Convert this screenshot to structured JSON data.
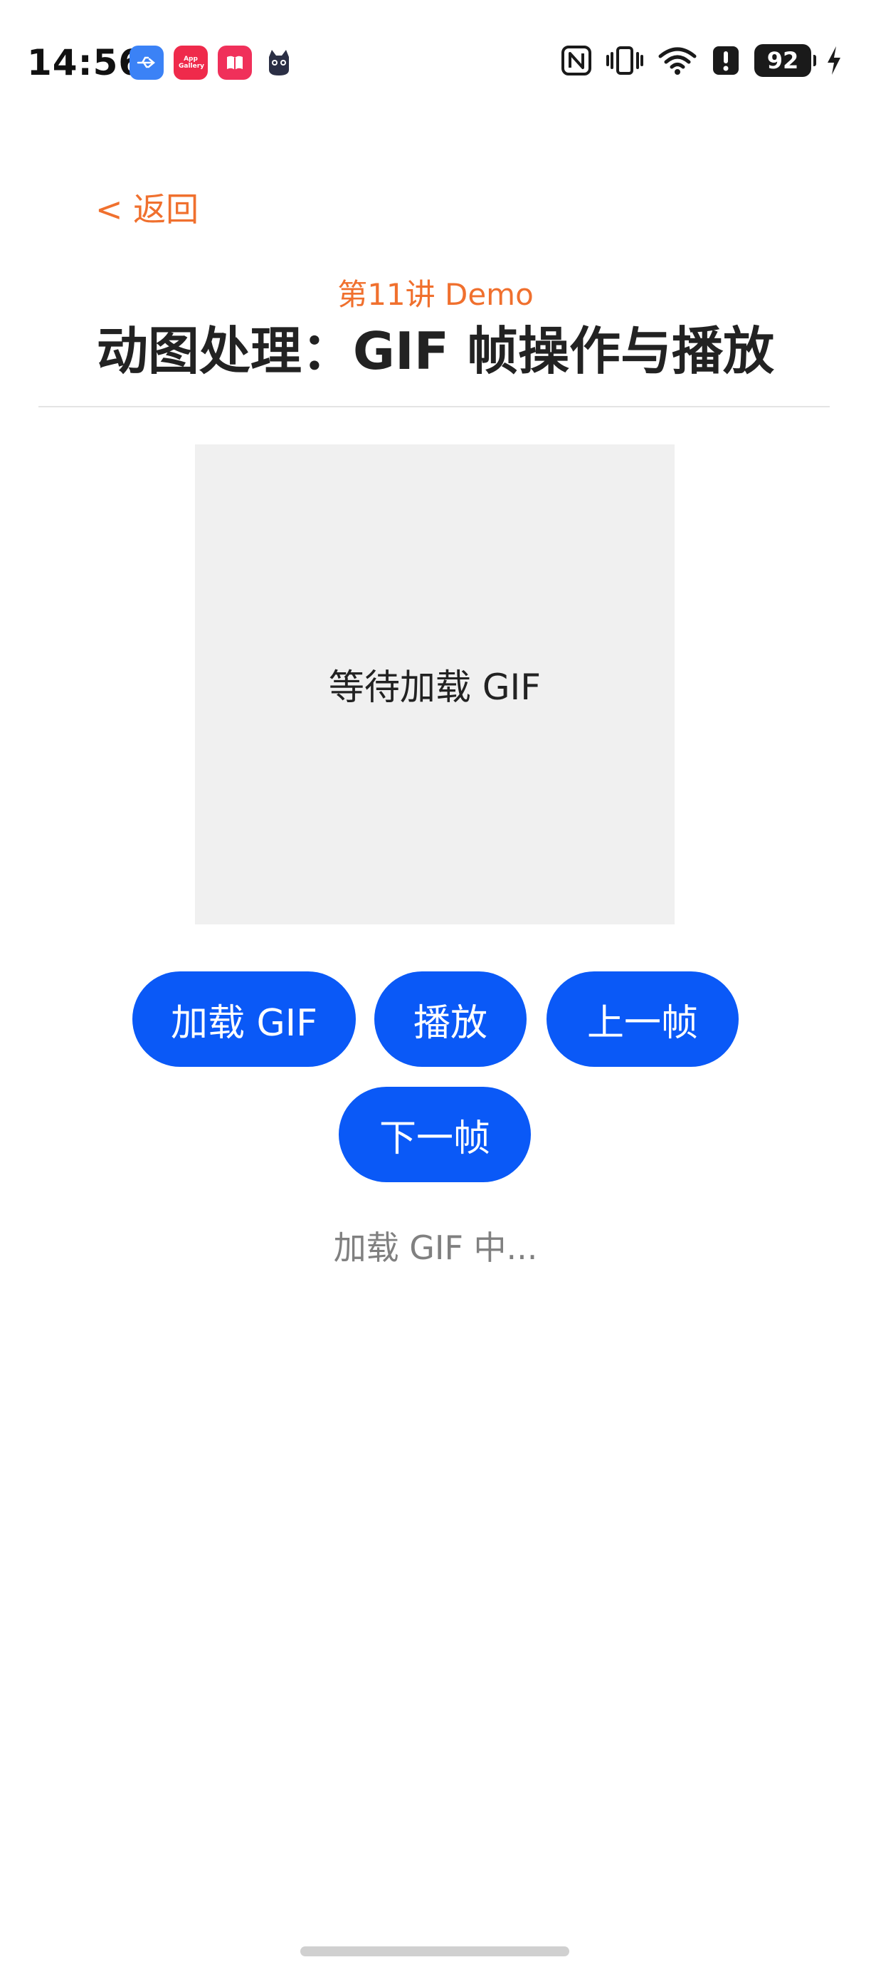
{
  "status_bar": {
    "time": "14:56",
    "notification_icons": [
      "usb-icon",
      "app-gallery-icon",
      "book-icon",
      "cat-app-icon"
    ],
    "gallery_label": "App Gallery",
    "right_icons": [
      "nfc-icon",
      "vibrate-icon",
      "wifi-icon",
      "alert-icon",
      "battery-icon",
      "charging-icon"
    ],
    "battery_level": "92"
  },
  "nav": {
    "back_label": "< 返回"
  },
  "header": {
    "subtitle": "第11讲 Demo",
    "title": "动图处理：GIF 帧操作与播放"
  },
  "preview": {
    "placeholder": "等待加载 GIF"
  },
  "controls": {
    "load_label": "加载 GIF",
    "play_label": "播放",
    "prev_label": "上一帧",
    "next_label": "下一帧"
  },
  "status": {
    "message": "加载 GIF 中..."
  },
  "colors": {
    "accent": "#f0702e",
    "button": "#0a59f7",
    "preview_bg": "#f0f0f0",
    "status_text": "#808080"
  }
}
